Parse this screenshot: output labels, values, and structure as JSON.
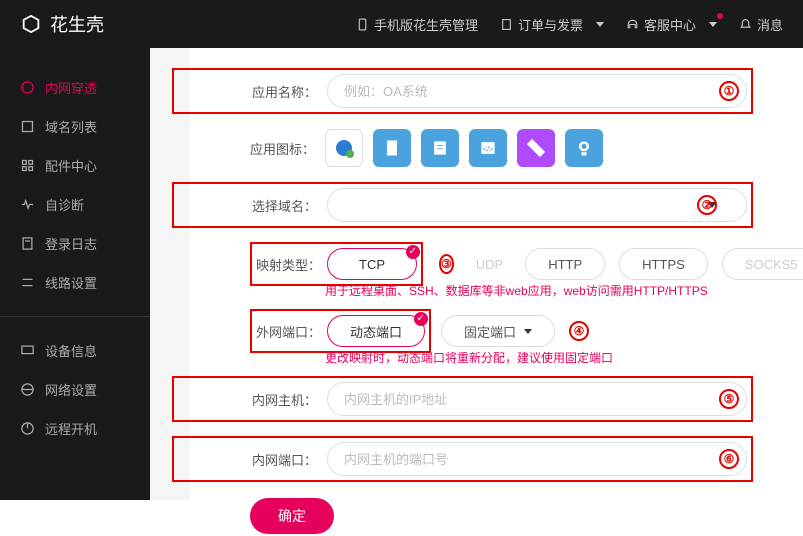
{
  "header": {
    "logo": "花生壳",
    "mobile": "手机版花生壳管理",
    "orders": "订单与发票",
    "support": "客服中心",
    "messages": "消息"
  },
  "sidebar": {
    "items": [
      {
        "label": "内网穿透"
      },
      {
        "label": "域名列表"
      },
      {
        "label": "配件中心"
      },
      {
        "label": "自诊断"
      },
      {
        "label": "登录日志"
      },
      {
        "label": "线路设置"
      }
    ],
    "lower": [
      {
        "label": "设备信息"
      },
      {
        "label": "网络设置"
      },
      {
        "label": "远程开机"
      }
    ]
  },
  "form": {
    "app_name_label": "应用名称：",
    "app_name_placeholder": "例如：OA系统",
    "app_icon_label": "应用图标：",
    "domain_label": "选择域名：",
    "map_type_label": "映射类型：",
    "map_types": [
      "TCP",
      "UDP",
      "HTTP",
      "HTTPS",
      "SOCKS5"
    ],
    "map_hint": "用于远程桌面、SSH、数据库等非web应用，web访问需用HTTP/HTTPS",
    "ext_port_label": "外网端口：",
    "ext_dynamic": "动态端口",
    "ext_fixed": "固定端口",
    "ext_hint": "更改映射时，动态端口将重新分配，建议使用固定端口",
    "host_label": "内网主机：",
    "host_placeholder": "内网主机的IP地址",
    "port_label": "内网端口：",
    "port_placeholder": "内网主机的端口号",
    "submit": "确定",
    "badges": [
      "①",
      "②",
      "③",
      "④",
      "⑤",
      "⑥"
    ]
  }
}
